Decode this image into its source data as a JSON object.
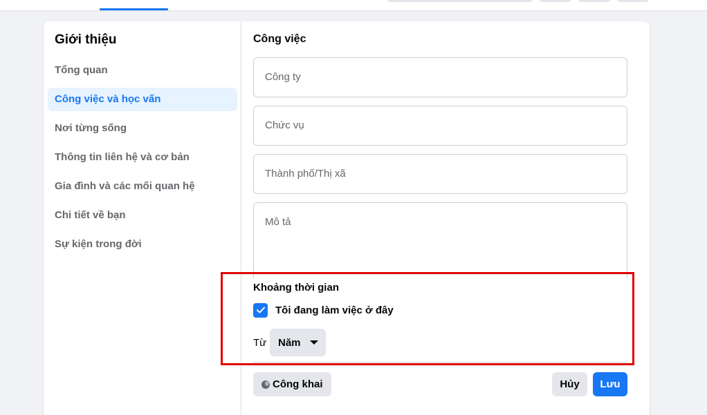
{
  "sidebar": {
    "title": "Giới thiệu",
    "items": [
      {
        "label": "Tổng quan"
      },
      {
        "label": "Công việc và học vấn"
      },
      {
        "label": "Nơi từng sống"
      },
      {
        "label": "Thông tin liên hệ và cơ bản"
      },
      {
        "label": "Gia đình và các mối quan hệ"
      },
      {
        "label": "Chi tiết về bạn"
      },
      {
        "label": "Sự kiện trong đời"
      }
    ],
    "active_index": 1
  },
  "form": {
    "section_title": "Công việc",
    "fields": {
      "company_placeholder": "Công ty",
      "position_placeholder": "Chức vụ",
      "city_placeholder": "Thành phố/Thị xã",
      "description_placeholder": "Mô tả"
    },
    "time_period": {
      "title": "Khoảng thời gian",
      "currently_working_label": "Tôi đang làm việc ở đây",
      "currently_working_checked": true,
      "from_label": "Từ",
      "year_select_value": "Năm"
    },
    "privacy_label": "Công khai",
    "cancel_label": "Hủy",
    "save_label": "Lưu"
  },
  "colors": {
    "accent": "#1877f2",
    "highlight": "#e00000"
  }
}
